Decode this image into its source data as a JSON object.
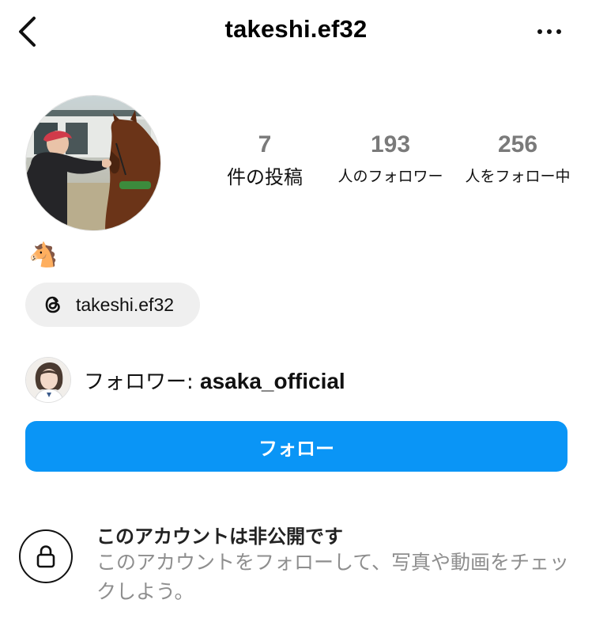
{
  "header": {
    "username": "takeshi.ef32",
    "back_icon": "chevron-left-icon",
    "more_icon": "more-horizontal-icon"
  },
  "stats": {
    "posts_count": "7",
    "posts_label": "件の投稿",
    "followers_count": "193",
    "followers_label": "人のフォロワー",
    "following_count": "256",
    "following_label": "人をフォロー中"
  },
  "bio": {
    "emoji": "🐴"
  },
  "threads_link": {
    "label": "takeshi.ef32",
    "icon": "threads-icon"
  },
  "followed_by": {
    "prefix": "フォロワー: ",
    "name": "asaka_official"
  },
  "follow_button": {
    "label": "フォロー"
  },
  "private_notice": {
    "title": "このアカウントは非公開です",
    "description": "このアカウントをフォローして、写真や動画をチェックしよう。",
    "icon": "lock-icon"
  },
  "colors": {
    "accent": "#0a95f6",
    "stat_number": "#7a7a7a",
    "secondary_text": "#8e8e8e",
    "pill_bg": "#efefef"
  }
}
